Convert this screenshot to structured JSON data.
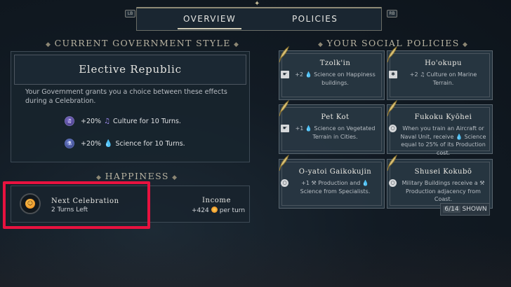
{
  "tabs": {
    "left_bumper": "LB",
    "right_bumper": "RB",
    "overview": "OVERVIEW",
    "policies": "POLICIES",
    "active": "overview"
  },
  "government": {
    "section_title": "CURRENT GOVERNMENT STYLE",
    "name": "Elective Republic",
    "description": "Your Government grants you a choice between these effects during a Celebration.",
    "effects": [
      {
        "amount": "+20%",
        "glyph": "♫",
        "text": "Culture for 10 Turns.",
        "icon": "culture-icon"
      },
      {
        "amount": "+20%",
        "glyph": "💧",
        "text": "Science for 10 Turns.",
        "icon": "science-icon"
      }
    ]
  },
  "happiness": {
    "section_title": "HAPPINESS",
    "next_label": "Next Celebration",
    "turns_left": "2 Turns Left",
    "income_label": "Income",
    "income_value": "+424",
    "income_suffix": "per turn"
  },
  "policies": {
    "section_title": "YOUR SOCIAL POLICIES",
    "shown_count": "6/14",
    "shown_label": "SHOWN",
    "cards": [
      {
        "name": "Tzolk'in",
        "desc": "+2 💧 Science on Happiness buildings."
      },
      {
        "name": "Ho'okupu",
        "desc": "+2 ♫ Culture on Marine Terrain."
      },
      {
        "name": "Pet Kot",
        "desc": "+1 💧 Science on Vegetated Terrain in Cities."
      },
      {
        "name": "Fukoku Kyōhei",
        "desc": "When you train an Aircraft or Naval Unit, receive 💧 Science equal to 25% of its Production cost."
      },
      {
        "name": "O-yatoi Gaikokujin",
        "desc": "+1 ⚒ Production and 💧 Science from Specialists."
      },
      {
        "name": "Shusei Kokubō",
        "desc": "Military Buildings receive a ⚒ Production adjacency from Coast."
      }
    ]
  },
  "colors": {
    "highlight_outline": "#e8123f",
    "panel_bg": "#18242e",
    "card_bg": "#283742"
  }
}
